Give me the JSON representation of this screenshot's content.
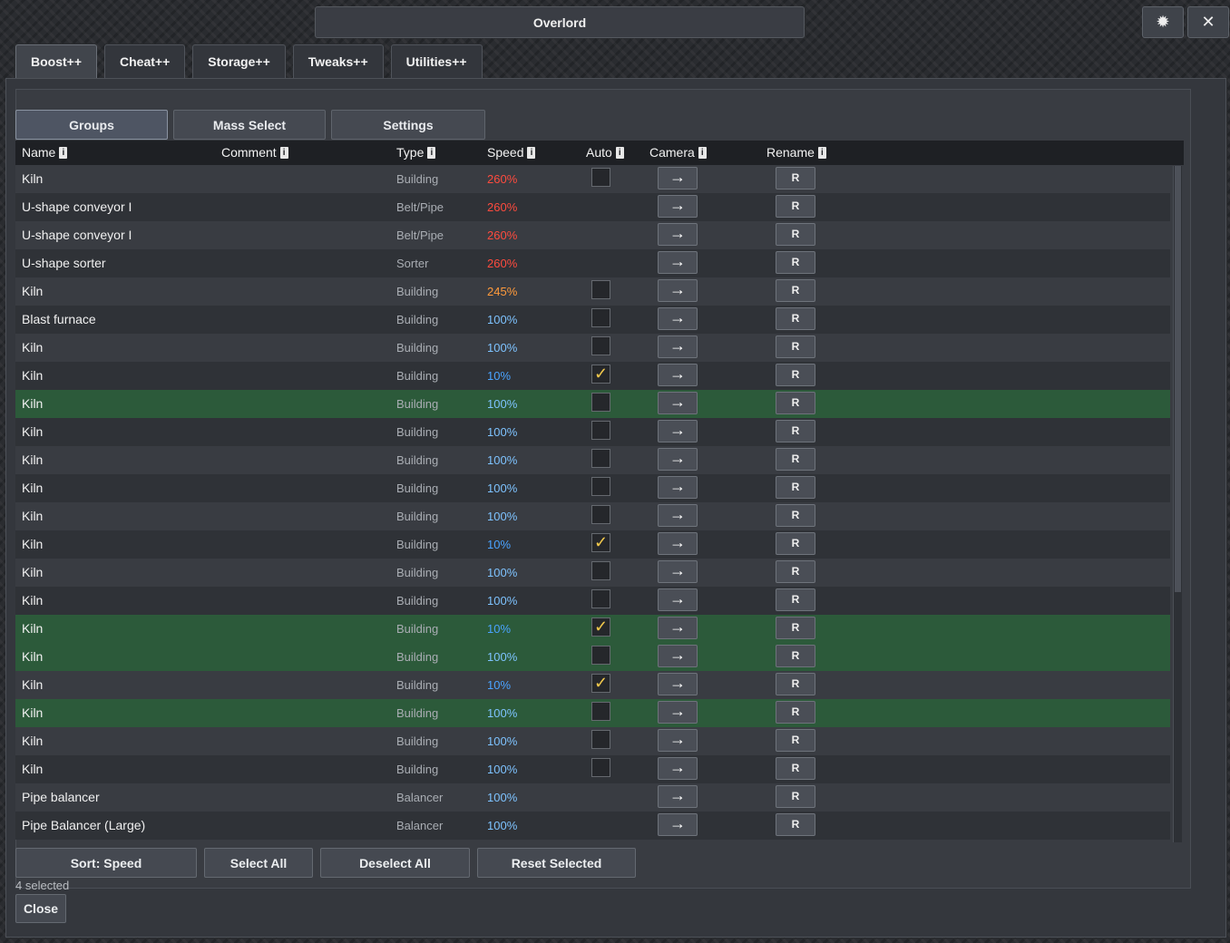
{
  "window": {
    "title": "Overlord",
    "pin_icon": "✹",
    "close_icon": "✕"
  },
  "tabs": [
    {
      "label": "Boost++",
      "active": true
    },
    {
      "label": "Cheat++",
      "active": false
    },
    {
      "label": "Storage++",
      "active": false
    },
    {
      "label": "Tweaks++",
      "active": false
    },
    {
      "label": "Utilities++",
      "active": false
    }
  ],
  "subtabs": [
    {
      "label": "Groups",
      "active": true
    },
    {
      "label": "Mass Select",
      "active": false
    },
    {
      "label": "Settings",
      "active": false
    }
  ],
  "columns": {
    "name": "Name",
    "comment": "Comment",
    "type": "Type",
    "speed": "Speed",
    "auto": "Auto",
    "camera": "Camera",
    "rename": "Rename",
    "info_glyph": "i"
  },
  "colors": {
    "speed_high": "#ff4b3e",
    "speed_mid": "#ff9a3c",
    "speed_normal": "#7ec3ff",
    "speed_low": "#4aa3ff",
    "selected_row": "#2c5a3a",
    "check": "#f2c94c"
  },
  "rows": [
    {
      "name": "Kiln",
      "type": "Building",
      "speed": "260%",
      "level": "high",
      "auto": "off",
      "selected": false
    },
    {
      "name": "U-shape conveyor I",
      "type": "Belt/Pipe",
      "speed": "260%",
      "level": "high",
      "auto": "none",
      "selected": false
    },
    {
      "name": "U-shape conveyor I",
      "type": "Belt/Pipe",
      "speed": "260%",
      "level": "high",
      "auto": "none",
      "selected": false
    },
    {
      "name": "U-shape sorter",
      "type": "Sorter",
      "speed": "260%",
      "level": "high",
      "auto": "none",
      "selected": false
    },
    {
      "name": "Kiln",
      "type": "Building",
      "speed": "245%",
      "level": "mid",
      "auto": "off",
      "selected": false
    },
    {
      "name": "Blast furnace",
      "type": "Building",
      "speed": "100%",
      "level": "normal",
      "auto": "off",
      "selected": false
    },
    {
      "name": "Kiln",
      "type": "Building",
      "speed": "100%",
      "level": "normal",
      "auto": "off",
      "selected": false
    },
    {
      "name": "Kiln",
      "type": "Building",
      "speed": "10%",
      "level": "low",
      "auto": "on",
      "selected": false
    },
    {
      "name": "Kiln",
      "type": "Building",
      "speed": "100%",
      "level": "normal",
      "auto": "off",
      "selected": true
    },
    {
      "name": "Kiln",
      "type": "Building",
      "speed": "100%",
      "level": "normal",
      "auto": "off",
      "selected": false
    },
    {
      "name": "Kiln",
      "type": "Building",
      "speed": "100%",
      "level": "normal",
      "auto": "off",
      "selected": false
    },
    {
      "name": "Kiln",
      "type": "Building",
      "speed": "100%",
      "level": "normal",
      "auto": "off",
      "selected": false
    },
    {
      "name": "Kiln",
      "type": "Building",
      "speed": "100%",
      "level": "normal",
      "auto": "off",
      "selected": false
    },
    {
      "name": "Kiln",
      "type": "Building",
      "speed": "10%",
      "level": "low",
      "auto": "on",
      "selected": false
    },
    {
      "name": "Kiln",
      "type": "Building",
      "speed": "100%",
      "level": "normal",
      "auto": "off",
      "selected": false
    },
    {
      "name": "Kiln",
      "type": "Building",
      "speed": "100%",
      "level": "normal",
      "auto": "off",
      "selected": false
    },
    {
      "name": "Kiln",
      "type": "Building",
      "speed": "10%",
      "level": "low",
      "auto": "on",
      "selected": true
    },
    {
      "name": "Kiln",
      "type": "Building",
      "speed": "100%",
      "level": "normal",
      "auto": "off",
      "selected": true
    },
    {
      "name": "Kiln",
      "type": "Building",
      "speed": "10%",
      "level": "low",
      "auto": "on",
      "selected": false
    },
    {
      "name": "Kiln",
      "type": "Building",
      "speed": "100%",
      "level": "normal",
      "auto": "off",
      "selected": true
    },
    {
      "name": "Kiln",
      "type": "Building",
      "speed": "100%",
      "level": "normal",
      "auto": "off",
      "selected": false
    },
    {
      "name": "Kiln",
      "type": "Building",
      "speed": "100%",
      "level": "normal",
      "auto": "off",
      "selected": false
    },
    {
      "name": "Pipe balancer",
      "type": "Balancer",
      "speed": "100%",
      "level": "normal",
      "auto": "none",
      "selected": false
    },
    {
      "name": "Pipe Balancer (Large)",
      "type": "Balancer",
      "speed": "100%",
      "level": "normal",
      "auto": "none",
      "selected": false
    }
  ],
  "row_buttons": {
    "camera_icon": "→",
    "rename_label": "R",
    "check_glyph": "✓"
  },
  "actions": {
    "sort": "Sort: Speed",
    "select_all": "Select All",
    "deselect_all": "Deselect All",
    "reset_selected": "Reset Selected"
  },
  "status": "4 selected",
  "close_label": "Close"
}
